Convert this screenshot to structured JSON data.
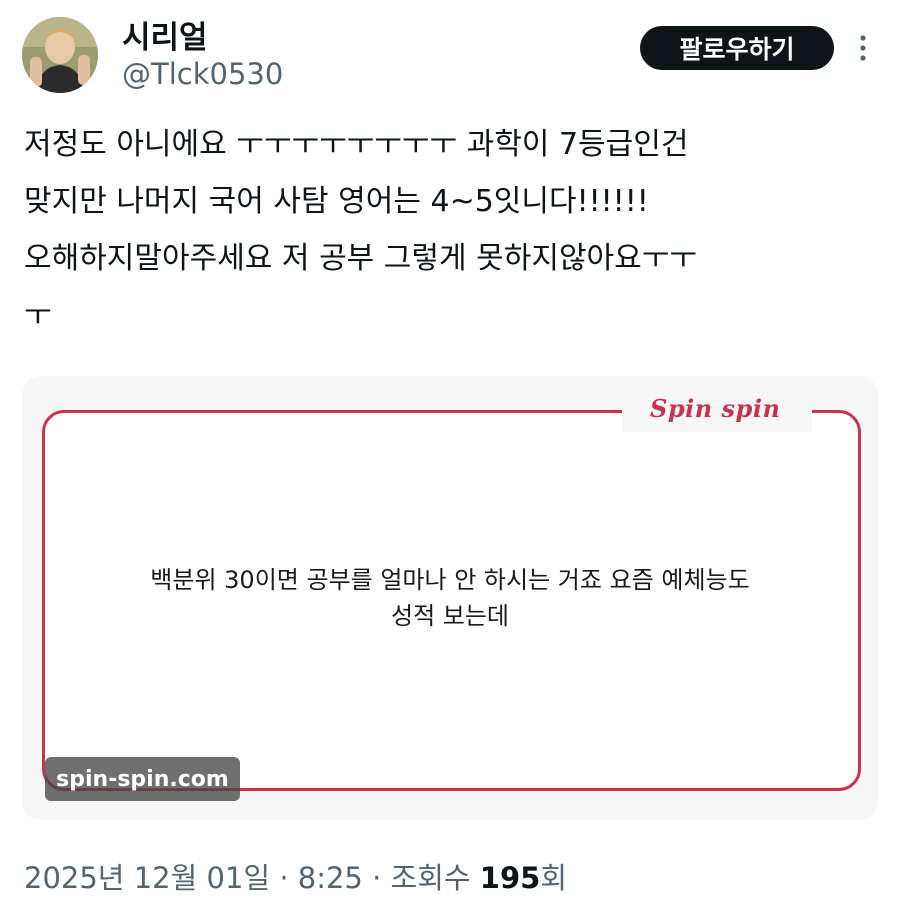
{
  "author": {
    "display_name": "시리얼",
    "handle": "@Tlck0530"
  },
  "header": {
    "follow_label": "팔로우하기"
  },
  "tweet": {
    "lines": [
      "저정도 아니에요 ㅜㅜㅜㅜㅜㅜㅜㅜ 과학이 7등급인건",
      "맞지만 나머지 국어 사탐 영어는 4~5잇니다!!!!!!",
      "오해하지말아주세요 저 공부 그렇게 못하지않아요ㅜㅜ",
      "ㅜ"
    ]
  },
  "card": {
    "brand": "Spin spin",
    "message_lines": [
      "백분위 30이면 공부를 얼마나 안 하시는 거죠 요즘 예체능도",
      "성적 보는데"
    ],
    "watermark": "spin-spin.com"
  },
  "meta": {
    "date": "2025년 12월 01일",
    "separator": "·",
    "time": "8:25",
    "views_label": "조회수",
    "views_count": "195",
    "views_suffix": "회"
  },
  "colors": {
    "accent_red": "#c8334b",
    "follow_bg": "#0f1419",
    "muted_text": "#536471"
  }
}
